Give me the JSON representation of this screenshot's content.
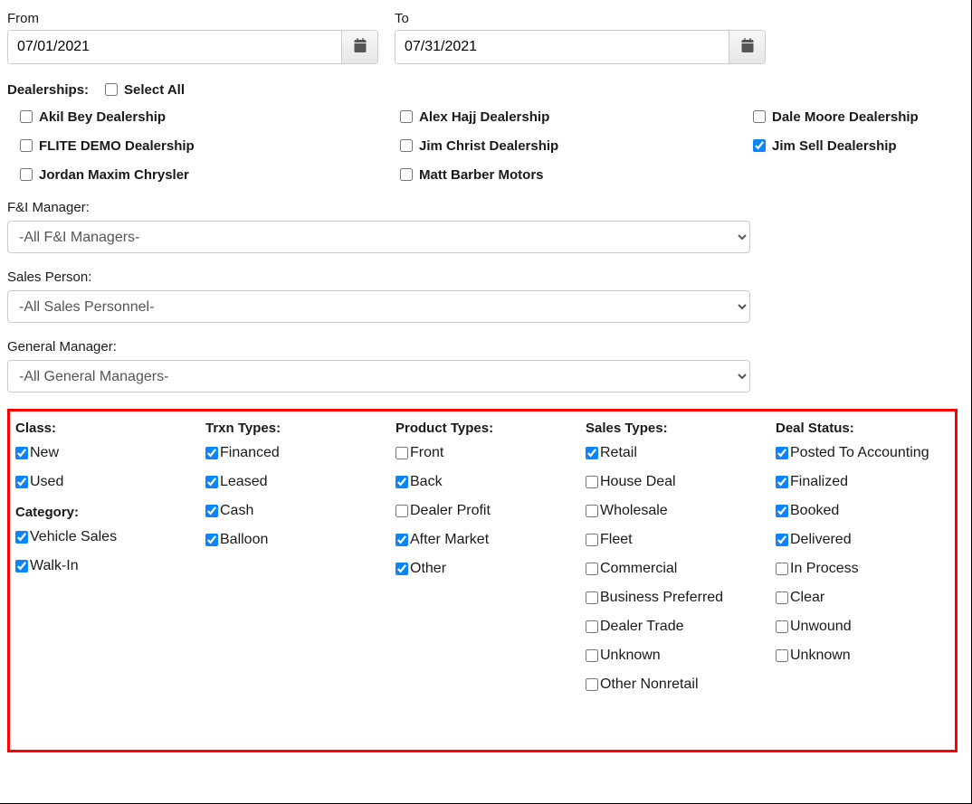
{
  "dateFrom": {
    "label": "From",
    "value": "07/01/2021"
  },
  "dateTo": {
    "label": "To",
    "value": "07/31/2021"
  },
  "dealerships": {
    "heading": "Dealerships:",
    "selectAllLabel": "Select All",
    "selectAllChecked": false,
    "items": [
      {
        "label": "Akil Bey Dealership",
        "checked": false
      },
      {
        "label": "Alex Hajj Dealership",
        "checked": false
      },
      {
        "label": "Dale Moore Dealership",
        "checked": false
      },
      {
        "label": "FLITE DEMO Dealership",
        "checked": false
      },
      {
        "label": "Jim Christ Dealership",
        "checked": false
      },
      {
        "label": "Jim Sell Dealership",
        "checked": true
      },
      {
        "label": "Jordan Maxim Chrysler",
        "checked": false
      },
      {
        "label": "Matt Barber Motors",
        "checked": false
      }
    ]
  },
  "fiManager": {
    "label": "F&I Manager:",
    "selected": "-All F&I Managers-"
  },
  "salesPerson": {
    "label": "Sales Person:",
    "selected": "-All Sales Personnel-"
  },
  "generalManager": {
    "label": "General Manager:",
    "selected": "-All General Managers-"
  },
  "filters": {
    "class": {
      "heading": "Class:",
      "items": [
        {
          "label": "New",
          "checked": true
        },
        {
          "label": "Used",
          "checked": true
        }
      ]
    },
    "category": {
      "heading": "Category:",
      "items": [
        {
          "label": "Vehicle Sales",
          "checked": true
        },
        {
          "label": "Walk-In",
          "checked": true
        }
      ]
    },
    "trxnTypes": {
      "heading": "Trxn Types:",
      "items": [
        {
          "label": "Financed",
          "checked": true
        },
        {
          "label": "Leased",
          "checked": true
        },
        {
          "label": "Cash",
          "checked": true
        },
        {
          "label": "Balloon",
          "checked": true
        }
      ]
    },
    "productTypes": {
      "heading": "Product Types:",
      "items": [
        {
          "label": "Front",
          "checked": false
        },
        {
          "label": "Back",
          "checked": true
        },
        {
          "label": "Dealer Profit",
          "checked": false
        },
        {
          "label": "After Market",
          "checked": true
        },
        {
          "label": "Other",
          "checked": true
        }
      ]
    },
    "salesTypes": {
      "heading": "Sales Types:",
      "items": [
        {
          "label": "Retail",
          "checked": true
        },
        {
          "label": "House Deal",
          "checked": false
        },
        {
          "label": "Wholesale",
          "checked": false
        },
        {
          "label": "Fleet",
          "checked": false
        },
        {
          "label": "Commercial",
          "checked": false
        },
        {
          "label": "Business Preferred",
          "checked": false
        },
        {
          "label": "Dealer Trade",
          "checked": false
        },
        {
          "label": "Unknown",
          "checked": false
        },
        {
          "label": "Other Nonretail",
          "checked": false
        }
      ]
    },
    "dealStatus": {
      "heading": "Deal Status:",
      "items": [
        {
          "label": "Posted To Accounting",
          "checked": true
        },
        {
          "label": "Finalized",
          "checked": true
        },
        {
          "label": "Booked",
          "checked": true
        },
        {
          "label": "Delivered",
          "checked": true
        },
        {
          "label": "In Process",
          "checked": false
        },
        {
          "label": "Clear",
          "checked": false
        },
        {
          "label": "Unwound",
          "checked": false
        },
        {
          "label": "Unknown",
          "checked": false
        }
      ]
    }
  }
}
